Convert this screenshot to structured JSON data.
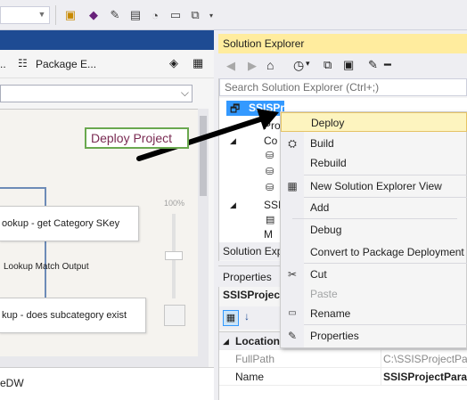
{
  "designer": {
    "tab_package_explorer": "Package E...",
    "node_lookup_category": "ookup - get Category SKey",
    "connector_label": "Lookup Match Output",
    "node_lookup_subcategory": "kup - does subcategory exist",
    "zoom_label": "100%",
    "bottom_text": "eDW"
  },
  "solution_explorer": {
    "title": "Solution Explorer",
    "search_placeholder": "Search Solution Explorer (Ctrl+;)",
    "selected_project": "SSISProjectParameters",
    "tree": {
      "row_pro": "Pro",
      "row_co": "Co",
      "row_ssi": "SSI",
      "row_m": "M"
    },
    "footer_label": "Solution Exp"
  },
  "properties": {
    "title": "Properties",
    "object_name": "SSISProjec",
    "category": "Location",
    "rows": [
      {
        "key": "FullPath",
        "value": "C:\\SSISProjectParam"
      },
      {
        "key": "Name",
        "value": "SSISProjectParam"
      }
    ]
  },
  "context_menu": {
    "items": [
      {
        "label": "Deploy",
        "icon": "none"
      },
      {
        "label": "Build",
        "icon": "build-icon"
      },
      {
        "label": "Rebuild",
        "icon": "none"
      },
      {
        "label": "New Solution Explorer View",
        "icon": "new-view-icon"
      },
      {
        "label": "Add",
        "icon": "none"
      },
      {
        "label": "Debug",
        "icon": "none"
      },
      {
        "label": "Convert to Package Deployment M",
        "icon": "none"
      },
      {
        "label": "Cut",
        "icon": "scissors-icon"
      },
      {
        "label": "Paste",
        "icon": "none"
      },
      {
        "label": "Rename",
        "icon": "rename-icon"
      },
      {
        "label": "Properties",
        "icon": "wrench-icon"
      }
    ]
  },
  "callout": {
    "text": "Deploy Project"
  },
  "colors": {
    "accent_blue": "#1e4b93",
    "selection_blue": "#3399ff",
    "se_title_yellow": "#ffec9e",
    "callout_border": "#6aa84f",
    "callout_text": "#7a2b53"
  }
}
